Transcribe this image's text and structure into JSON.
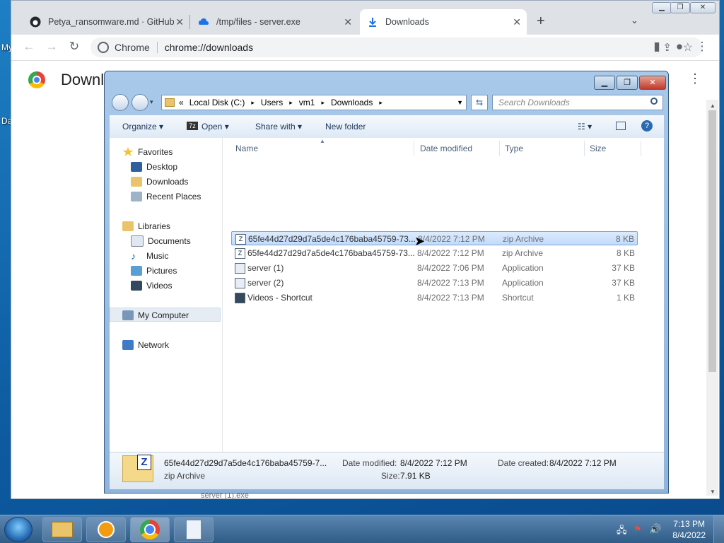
{
  "desktop": {
    "label_my": "My",
    "label_da": "Da"
  },
  "chrome": {
    "tabs": [
      {
        "title": "Petya_ransomware.md · GitHub",
        "icon": "github-icon"
      },
      {
        "title": "/tmp/files - server.exe",
        "icon": "cloud-icon"
      },
      {
        "title": "Downloads",
        "icon": "download-icon"
      }
    ],
    "omnibox_site": "Chrome",
    "omnibox_url": "chrome://downloads",
    "page_title": "Downloads",
    "page_title_visible": "Downl",
    "bottom_item": "server (1).exe"
  },
  "explorer": {
    "breadcrumb": [
      "«",
      "Local Disk (C:)",
      "Users",
      "vm1",
      "Downloads"
    ],
    "search_placeholder": "Search Downloads",
    "commands": {
      "organize": "Organize",
      "open": "Open",
      "share": "Share with",
      "new_folder": "New folder"
    },
    "nav": {
      "favorites": "Favorites",
      "fav_items": [
        "Desktop",
        "Downloads",
        "Recent Places"
      ],
      "libraries": "Libraries",
      "lib_items": [
        "Documents",
        "Music",
        "Pictures",
        "Videos"
      ],
      "computer": "My Computer",
      "network": "Network"
    },
    "columns": {
      "name": "Name",
      "date": "Date modified",
      "type": "Type",
      "size": "Size"
    },
    "files": [
      {
        "name": "65fe44d27d29d7a5de4c176baba45759-73...",
        "date": "8/4/2022 7:12 PM",
        "type": "zip Archive",
        "size": "8 KB",
        "selected": true
      },
      {
        "name": "65fe44d27d29d7a5de4c176baba45759-73...",
        "date": "8/4/2022 7:12 PM",
        "type": "zip Archive",
        "size": "8 KB",
        "selected": false
      },
      {
        "name": "server (1)",
        "date": "8/4/2022 7:06 PM",
        "type": "Application",
        "size": "37 KB",
        "selected": false
      },
      {
        "name": "server (2)",
        "date": "8/4/2022 7:13 PM",
        "type": "Application",
        "size": "37 KB",
        "selected": false
      },
      {
        "name": "Videos - Shortcut",
        "date": "8/4/2022 7:13 PM",
        "type": "Shortcut",
        "size": "1 KB",
        "selected": false
      }
    ],
    "details": {
      "filename": "65fe44d27d29d7a5de4c176baba45759-7...",
      "filetype": "zip Archive",
      "modified_label": "Date modified:",
      "modified_value": "8/4/2022 7:12 PM",
      "size_label": "Size:",
      "size_value": "7.91 KB",
      "created_label": "Date created:",
      "created_value": "8/4/2022 7:12 PM"
    }
  },
  "taskbar": {
    "time": "7:13 PM",
    "date": "8/4/2022"
  },
  "colors": {
    "accent": "#1a73e8",
    "explorer_frame": "#a9c9ea",
    "selection": "#c1dbfc"
  }
}
